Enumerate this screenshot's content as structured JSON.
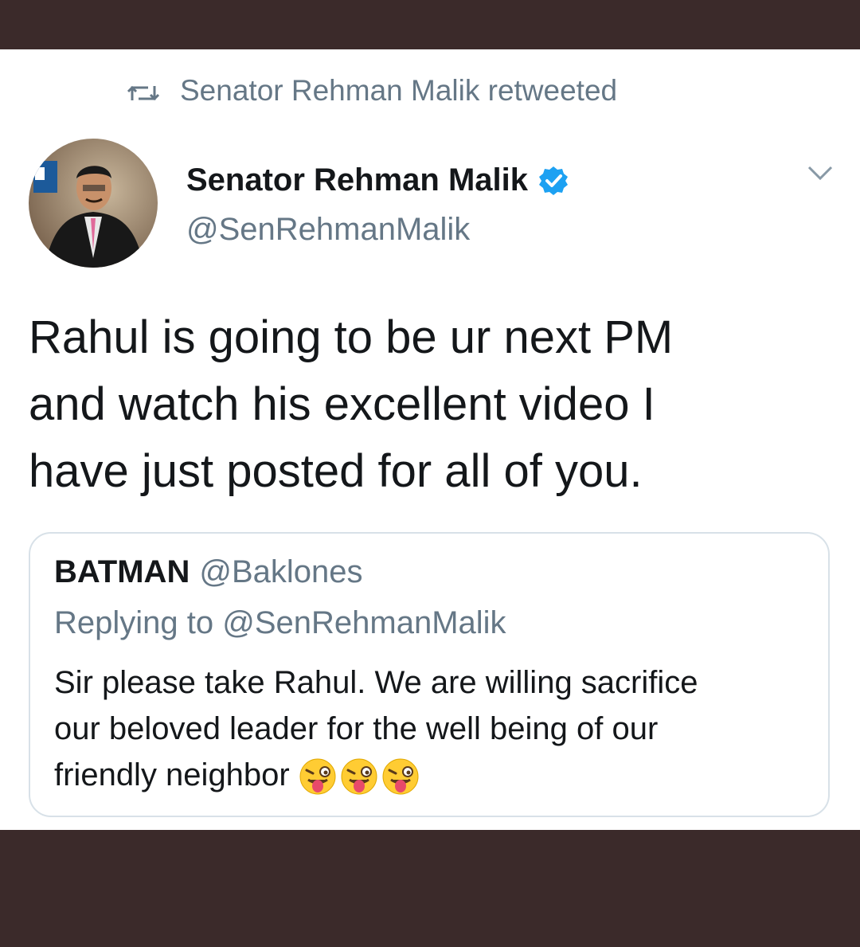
{
  "retweet": {
    "label": "Senator Rehman Malik retweeted",
    "icon": "retweet-icon"
  },
  "author": {
    "display_name": "Senator Rehman Malik",
    "handle": "@SenRehmanMalik",
    "verified": true
  },
  "tweet": {
    "line1": "Rahul is going to be ur next PM",
    "line2": "and watch his excellent video I",
    "line3": "have just posted for all of you."
  },
  "quote": {
    "name": "BATMAN",
    "handle": "@Baklones",
    "replying_to": "Replying to @SenRehmanMalik",
    "line1": "Sir please take Rahul. We are willing sacrifice",
    "line2": "our beloved leader for the well  being of our",
    "line3": "friendly neighbor",
    "emojis": [
      "tongue-wink-emoji",
      "tongue-wink-emoji",
      "tongue-wink-emoji"
    ]
  },
  "colors": {
    "frame": "#3b2a2a",
    "text": "#14171a",
    "muted": "#657786",
    "verified": "#1da1f2",
    "border": "#d8e1e8"
  }
}
